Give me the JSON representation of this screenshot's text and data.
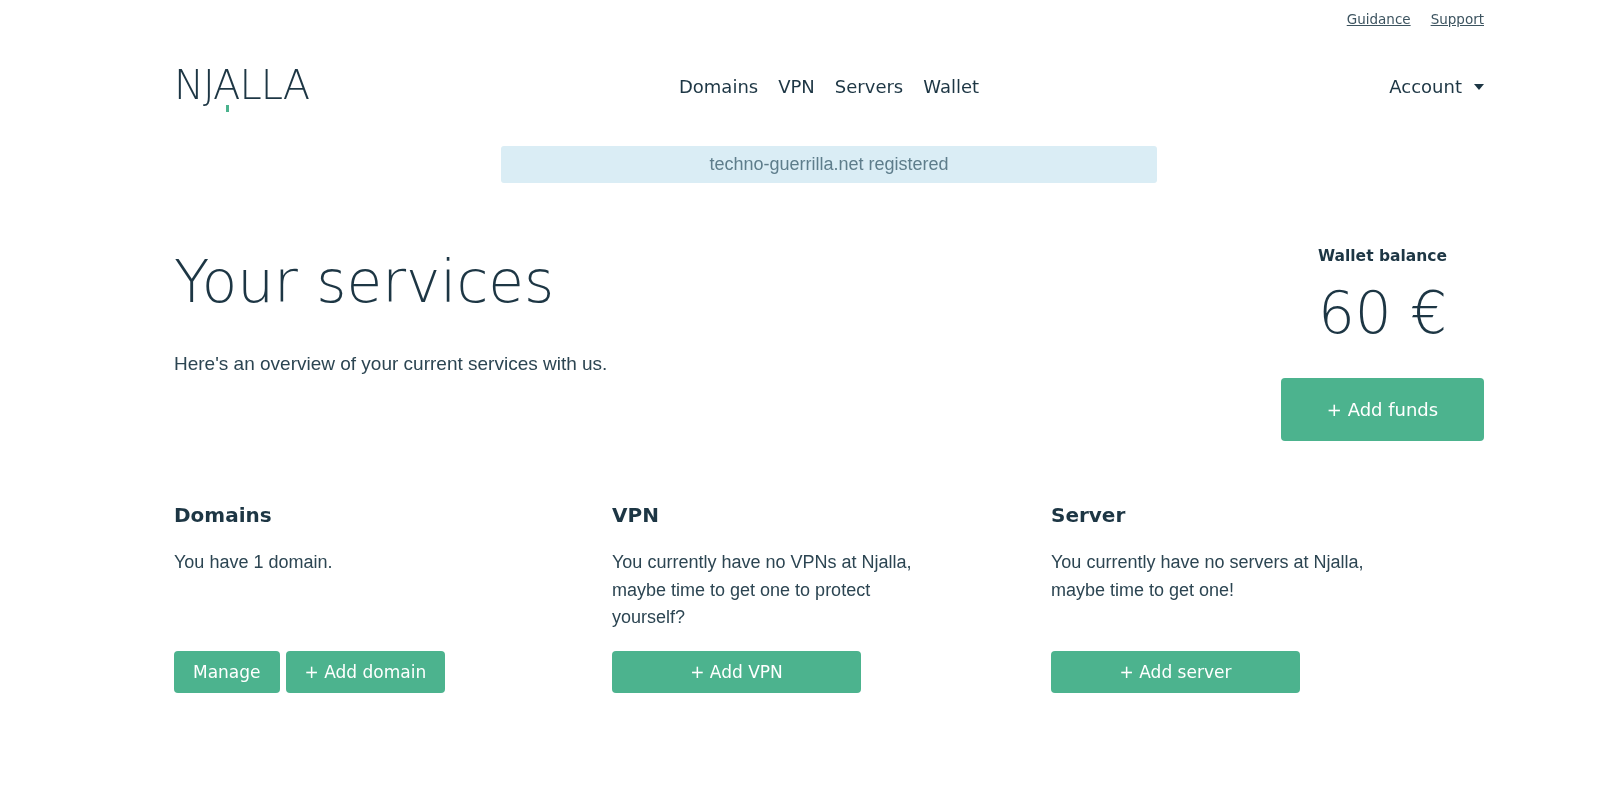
{
  "top_links": [
    {
      "label": "Guidance"
    },
    {
      "label": "Support"
    }
  ],
  "header": {
    "logo": "NJALLA",
    "nav": [
      {
        "label": "Domains"
      },
      {
        "label": "VPN"
      },
      {
        "label": "Servers"
      },
      {
        "label": "Wallet"
      }
    ],
    "account": {
      "label": "Account"
    }
  },
  "notification": {
    "text": "techno-guerrilla.net registered"
  },
  "intro": {
    "title": "Your services",
    "subtitle": "Here's an overview of your current services with us."
  },
  "wallet": {
    "label": "Wallet balance",
    "balance": "60 €",
    "button": "+ Add funds"
  },
  "services": [
    {
      "title": "Domains",
      "text": "You have 1 domain.",
      "buttons": [
        "Manage",
        "+ Add domain"
      ]
    },
    {
      "title": "VPN",
      "text": "You currently have no VPNs at Njalla, maybe time to get one to protect yourself?",
      "buttons": [
        "+ Add VPN"
      ]
    },
    {
      "title": "Server",
      "text": "You currently have no servers at Njalla, maybe time to get one!",
      "buttons": [
        "+ Add server"
      ]
    }
  ]
}
